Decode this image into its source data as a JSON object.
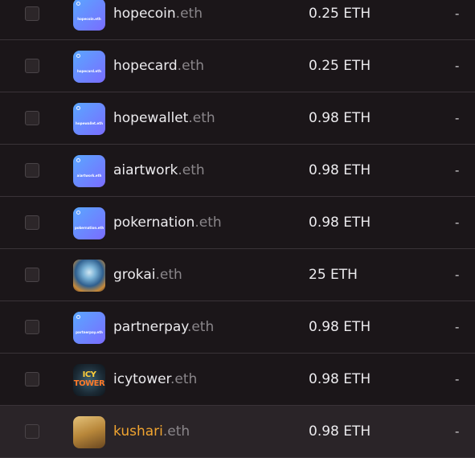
{
  "rows": [
    {
      "label": "hopecoin",
      "tld": ".eth",
      "price": "0.25 ETH",
      "extra": "-",
      "avatar_text": "hopecoin.eth"
    },
    {
      "label": "hopecard",
      "tld": ".eth",
      "price": "0.25 ETH",
      "extra": "-",
      "avatar_text": "hopecard.eth"
    },
    {
      "label": "hopewallet",
      "tld": ".eth",
      "price": "0.98 ETH",
      "extra": "-",
      "avatar_text": "hopewallet.eth"
    },
    {
      "label": "aiartwork",
      "tld": ".eth",
      "price": "0.98 ETH",
      "extra": "-",
      "avatar_text": "aiartwork.eth"
    },
    {
      "label": "pokernation",
      "tld": ".eth",
      "price": "0.98 ETH",
      "extra": "-",
      "avatar_text": "pokernation.eth"
    },
    {
      "label": "grokai",
      "tld": ".eth",
      "price": "25 ETH",
      "extra": "-"
    },
    {
      "label": "partnerpay",
      "tld": ".eth",
      "price": "0.98 ETH",
      "extra": "-",
      "avatar_text": "partnerpay.eth"
    },
    {
      "label": "icytower",
      "tld": ".eth",
      "price": "0.98 ETH",
      "extra": "-",
      "avatar_text_1": "ICY",
      "avatar_text_2": "TOWER"
    },
    {
      "label": "kushari",
      "tld": ".eth",
      "price": "0.98 ETH",
      "extra": "-"
    }
  ],
  "colors": {
    "background": "#1b1619",
    "row_divider": "#3a3338",
    "highlight_row": "#2a2428",
    "highlight_name": "#f0a430",
    "tld": "#8a868a",
    "avatar_gradient_start": "#5aa7ff",
    "avatar_gradient_end": "#7a6cff"
  }
}
